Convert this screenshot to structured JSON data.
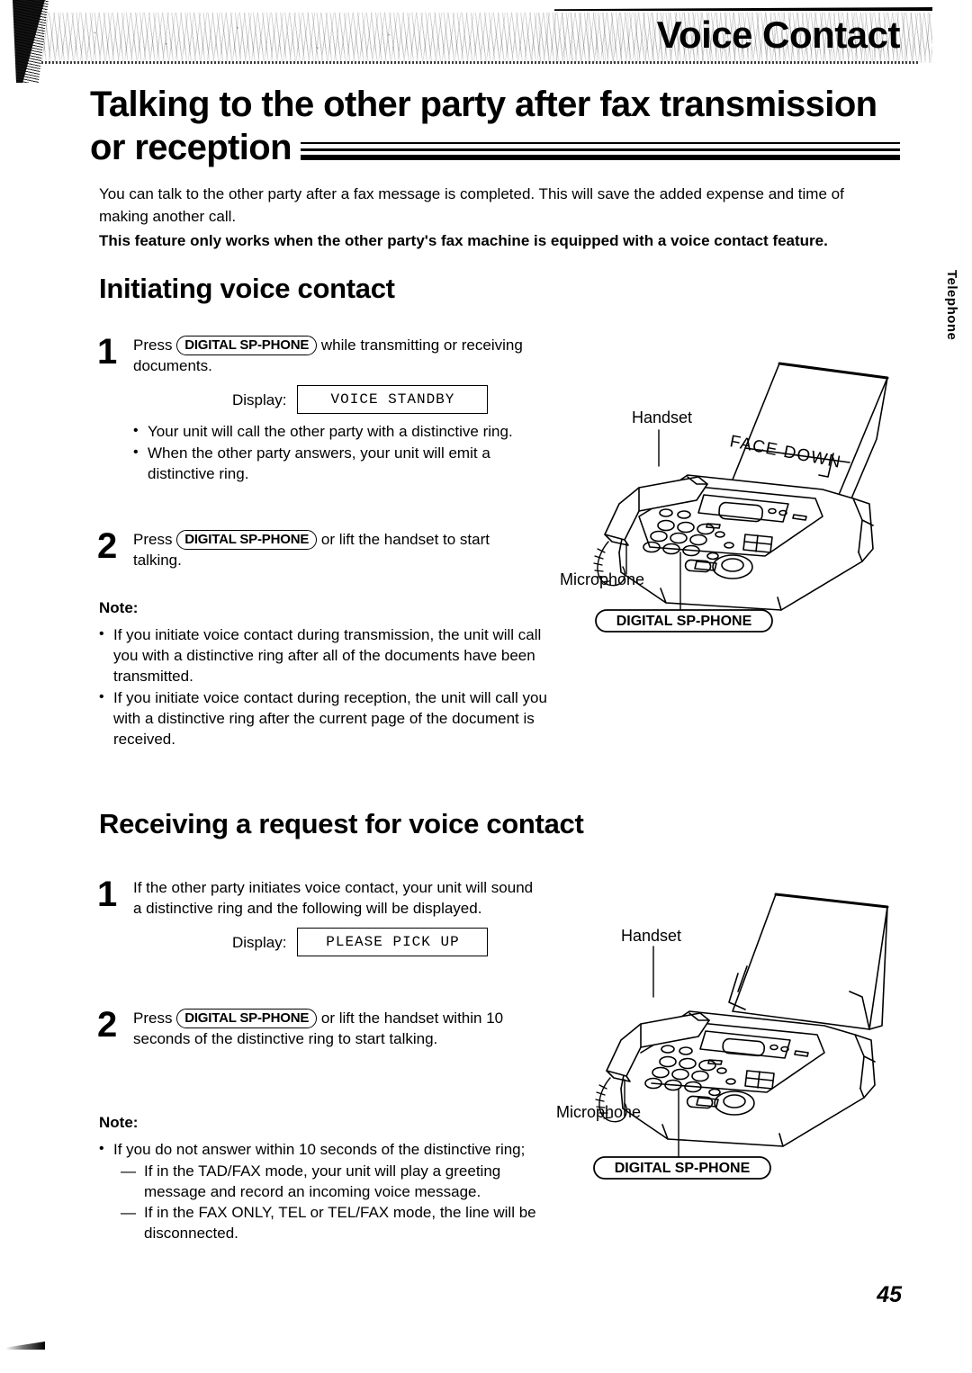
{
  "header": {
    "banner_title": "Voice Contact",
    "side_tab": "Telephone"
  },
  "main_title": {
    "line1": "Talking to the other party after fax transmission",
    "line2": "or reception"
  },
  "intro": {
    "paragraph": "You can talk to the other party after a fax message is completed. This will save the added expense and time of making another call.",
    "bold_note": "This feature only works when the other party's fax machine is equipped with a voice contact feature."
  },
  "sections": [
    {
      "heading": "Initiating voice contact",
      "steps": [
        {
          "number": "1",
          "text_before": "Press",
          "key": "DIGITAL SP-PHONE",
          "text_after": "while transmitting or receiving documents.",
          "display_label": "Display:",
          "display_value": "VOICE STANDBY",
          "bullets": [
            "Your unit will call the other party with a distinctive ring.",
            "When the other party answers, your unit will emit a distinctive ring."
          ]
        },
        {
          "number": "2",
          "text_before": "Press",
          "key": "DIGITAL SP-PHONE",
          "text_after": "or lift the handset to start talking."
        }
      ],
      "note": {
        "title": "Note:",
        "bullets": [
          "If you initiate voice contact during transmission, the unit will call you with a distinctive ring after all of the documents have been transmitted.",
          "If you initiate voice contact during reception, the unit will call you with a distinctive ring after the current page of the document is received."
        ]
      },
      "illustration": {
        "label_handset": "Handset",
        "label_microphone": "Microphone",
        "label_paper": "FACE DOWN",
        "callout": "DIGITAL SP-PHONE"
      }
    },
    {
      "heading": "Receiving a request for voice contact",
      "steps": [
        {
          "number": "1",
          "text": "If the other party initiates voice contact, your unit will sound a distinctive ring and the following will be displayed.",
          "display_label": "Display:",
          "display_value": "PLEASE PICK UP"
        },
        {
          "number": "2",
          "text_before": "Press",
          "key": "DIGITAL SP-PHONE",
          "text_after": "or lift the handset within 10 seconds of the distinctive ring to start talking."
        }
      ],
      "note": {
        "title": "Note:",
        "bullets": [
          "If you do not answer within 10 seconds of the distinctive ring;"
        ],
        "subitems": [
          "If in the TAD/FAX mode, your unit will play a greeting message and record an incoming voice message.",
          "If in the FAX ONLY, TEL or TEL/FAX mode, the line will be disconnected."
        ]
      },
      "illustration": {
        "label_handset": "Handset",
        "label_microphone": "Microphone",
        "callout": "DIGITAL SP-PHONE"
      }
    }
  ],
  "footer": {
    "page_number": "45"
  }
}
